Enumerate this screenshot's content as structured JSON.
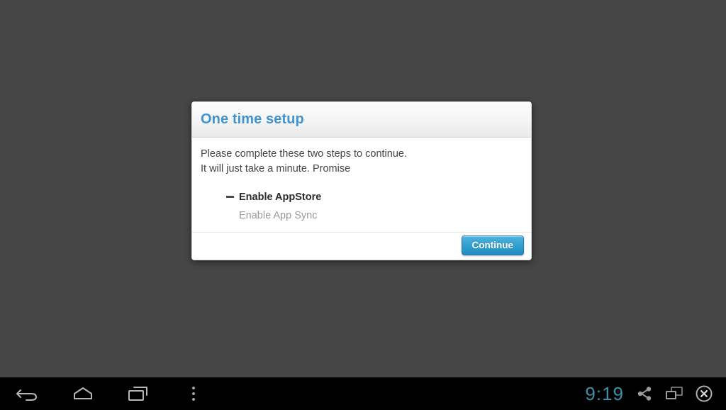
{
  "dialog": {
    "title": "One time setup",
    "intro_lines": [
      "Please complete these two steps to continue.",
      "It will just take a minute. Promise"
    ],
    "steps": [
      {
        "label": "Enable AppStore",
        "state": "done",
        "marker": "dash-marker"
      },
      {
        "label": "Enable App Sync",
        "state": "pending",
        "marker": "none"
      }
    ],
    "continue_label": "Continue",
    "title_color": "#4093cd",
    "button_color": "#35a1d2"
  },
  "navbar": {
    "back_icon": "back-arrow-icon",
    "home_icon": "home-icon",
    "recents_icon": "recent-apps-icon",
    "menu_icon": "overflow-menu-icon",
    "clock": "9:19",
    "clock_color": "#3f8fa8",
    "share_icon": "share-icon",
    "cast_icon": "screen-mirror-icon",
    "close_icon": "close-circle-icon"
  },
  "backdrop": {
    "color": "#464646"
  }
}
